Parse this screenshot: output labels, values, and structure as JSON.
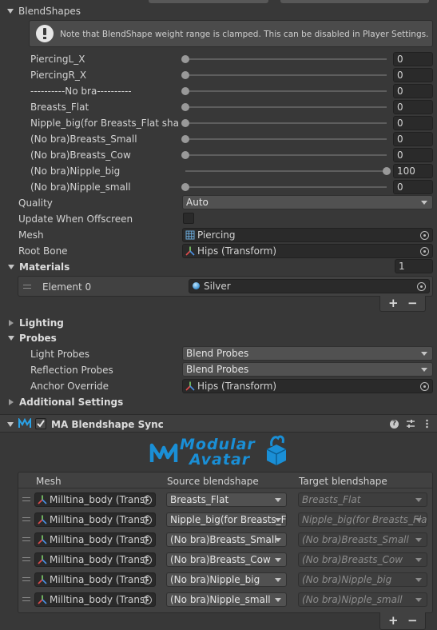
{
  "blendshapes": {
    "header": "BlendShapes",
    "notice": "Note that BlendShape weight range is clamped. This can be disabled in Player Settings.",
    "rows": [
      {
        "label": "PiercingL_X",
        "value": "0",
        "level": 0
      },
      {
        "label": "PiercingR_X",
        "value": "0",
        "level": 0
      },
      {
        "label": "----------No bra----------",
        "value": "0",
        "level": 0
      },
      {
        "label": "Breasts_Flat",
        "value": "0",
        "level": 0
      },
      {
        "label": "Nipple_big(for Breasts_Flat shape",
        "value": "0",
        "level": 0
      },
      {
        "label": "(No bra)Breasts_Small",
        "value": "0",
        "level": 0
      },
      {
        "label": "(No bra)Breasts_Cow",
        "value": "0",
        "level": 0
      },
      {
        "label": "(No bra)Nipple_big",
        "value": "100",
        "level": 1
      },
      {
        "label": "(No bra)Nipple_small",
        "value": "0",
        "level": 0
      }
    ]
  },
  "renderer": {
    "quality_label": "Quality",
    "quality_value": "Auto",
    "update_offscreen_label": "Update When Offscreen",
    "mesh_label": "Mesh",
    "mesh_value": "Piercing",
    "root_bone_label": "Root Bone",
    "root_bone_value": "Hips (Transform)"
  },
  "materials": {
    "header": "Materials",
    "count": "1",
    "element_label": "Element 0",
    "element_value": "Silver"
  },
  "sections": {
    "lighting": "Lighting",
    "probes": "Probes",
    "additional": "Additional Settings"
  },
  "probes": {
    "light_label": "Light Probes",
    "light_value": "Blend Probes",
    "reflection_label": "Reflection Probes",
    "reflection_value": "Blend Probes",
    "anchor_label": "Anchor Override",
    "anchor_value": "Hips (Transform)"
  },
  "component": {
    "title": "MA Blendshape Sync",
    "logo_line1": "Modular",
    "logo_line2": "Avatar"
  },
  "sync_table": {
    "col_mesh": "Mesh",
    "col_source": "Source blendshape",
    "col_target": "Target blendshape",
    "rows": [
      {
        "mesh": "Milltina_body (Transf",
        "source": "Breasts_Flat",
        "target": "Breasts_Flat"
      },
      {
        "mesh": "Milltina_body (Transf",
        "source": "Nipple_big(for Breasts_F",
        "target": "Nipple_big(for Breasts_Fla"
      },
      {
        "mesh": "Milltina_body (Transf",
        "source": "(No bra)Breasts_Small",
        "target": "(No bra)Breasts_Small"
      },
      {
        "mesh": "Milltina_body (Transf",
        "source": "(No bra)Breasts_Cow",
        "target": "(No bra)Breasts_Cow"
      },
      {
        "mesh": "Milltina_body (Transf",
        "source": "(No bra)Nipple_big",
        "target": "(No bra)Nipple_big"
      },
      {
        "mesh": "Milltina_body (Transf",
        "source": "(No bra)Nipple_small",
        "target": "(No bra)Nipple_small"
      }
    ]
  },
  "buttons": {
    "plus": "+",
    "minus": "−"
  },
  "colors": {
    "logo_blue": "#1a8fd6",
    "panel": "#383838",
    "field": "#2a2a2a"
  }
}
